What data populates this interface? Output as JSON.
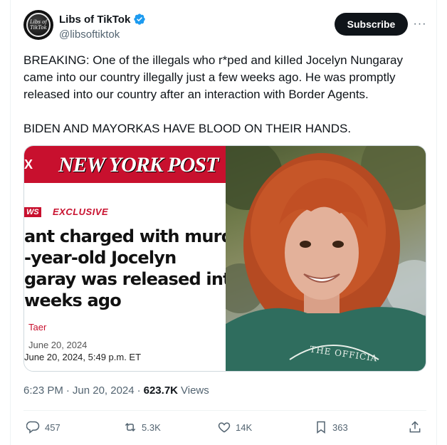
{
  "author": {
    "display_name": "Libs of TikTok",
    "handle": "@libsoftiktok",
    "avatar_text": "Libs of TikTok"
  },
  "header": {
    "subscribe_label": "Subscribe",
    "more_label": "···"
  },
  "tweet": {
    "text": "BREAKING: One of the illegals who r*ped and kiIled Jocelyn Nungaray came into our country illegally just a few weeks ago. He was promptly released into our country after an interaction with Border Agents.\n\nBIDEN AND MAYORKAS HAVE BLOOD ON THEIR HANDS."
  },
  "media": {
    "article": {
      "x_mark": "X",
      "logo": "NEW YORK POST",
      "tag": "WS",
      "section": "EXCLUSIVE",
      "headline": "ant charged with murd\n-year-old Jocelyn\ngaray was released into\nweeks ago",
      "byline": "Taer",
      "date_published": "June 20, 2024",
      "date_updated": "June 20, 2024, 5:49 p.m. ET"
    },
    "photo": {
      "shirt_text": "THE OFFICIA"
    }
  },
  "meta": {
    "time": "6:23 PM",
    "separator1": "·",
    "date": "Jun 20, 2024",
    "separator2": "·",
    "views_count": "623.7K",
    "views_label": "Views"
  },
  "actions": {
    "replies": "457",
    "reposts": "5.3K",
    "likes": "14K",
    "bookmarks": "363"
  },
  "colors": {
    "verified_blue": "#1d9bf0",
    "nyp_red": "#c8102e",
    "text_primary": "#0f1419",
    "text_secondary": "#536471"
  }
}
